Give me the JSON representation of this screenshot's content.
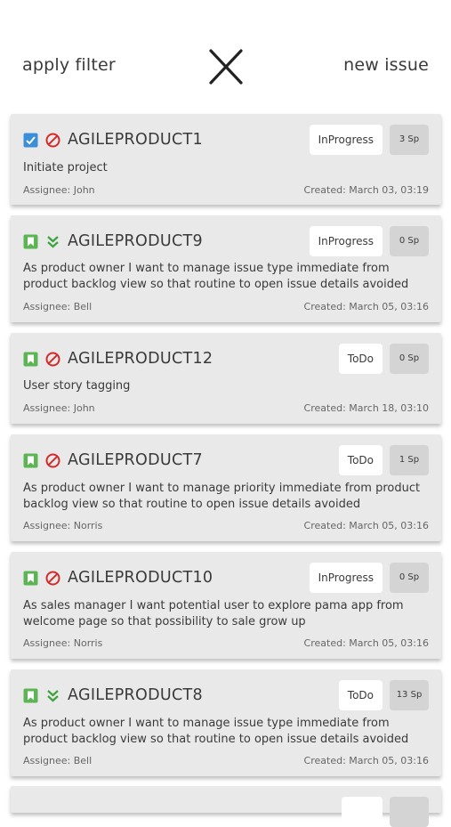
{
  "header": {
    "apply_filter": "apply filter",
    "new_issue": "new issue"
  },
  "issues": [
    {
      "key": "AGILEPRODUCT1",
      "type_icon": "checkbox-icon",
      "priority_icon": "blocker-icon",
      "status": "InProgress",
      "points": "3 Sp",
      "summary": "Initiate project",
      "assignee": "Assignee: John",
      "created": "Created: March 03, 03:19"
    },
    {
      "key": "AGILEPRODUCT9",
      "type_icon": "story-icon",
      "priority_icon": "lowest-priority-icon",
      "status": "InProgress",
      "points": "0 Sp",
      "summary": "As product owner I want to manage issue type immediate from product backlog view so that routine to open issue details avoided",
      "assignee": "Assignee: Bell",
      "created": "Created: March 05, 03:16"
    },
    {
      "key": "AGILEPRODUCT12",
      "type_icon": "story-icon",
      "priority_icon": "blocker-icon",
      "status": "ToDo",
      "points": "0 Sp",
      "summary": "User story tagging",
      "assignee": "Assignee: John",
      "created": "Created: March 18, 03:10"
    },
    {
      "key": "AGILEPRODUCT7",
      "type_icon": "story-icon",
      "priority_icon": "blocker-icon",
      "status": "ToDo",
      "points": "1 Sp",
      "summary": "As product owner I want to manage priority immediate from product backlog view so that routine to open issue details avoided",
      "assignee": "Assignee: Norris",
      "created": "Created: March 05, 03:16"
    },
    {
      "key": "AGILEPRODUCT10",
      "type_icon": "story-icon",
      "priority_icon": "blocker-icon",
      "status": "InProgress",
      "points": "0 Sp",
      "summary": "As sales manager I want potential user to explore pama app from welcome page so that possibility to sale grow up",
      "assignee": "Assignee: Norris",
      "created": "Created: March 05, 03:16"
    },
    {
      "key": "AGILEPRODUCT8",
      "type_icon": "story-icon",
      "priority_icon": "lowest-priority-icon",
      "status": "ToDo",
      "points": "13 Sp",
      "summary": "As product owner I want to manage issue type immediate from product backlog view so that routine to open issue details avoided",
      "assignee": "Assignee: Bell",
      "created": "Created: March 05, 03:16"
    }
  ],
  "colors": {
    "checkbox": "#3b8fd9",
    "story": "#5ab552",
    "blocker": "#d42a2a",
    "lowest": "#3aa33a",
    "card": "#e9e9e9"
  }
}
